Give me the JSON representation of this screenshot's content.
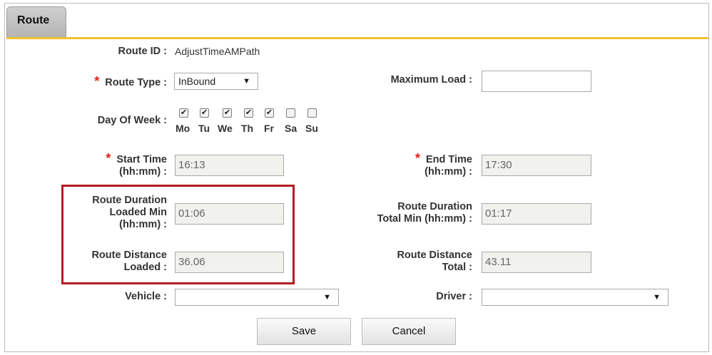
{
  "tab": {
    "label": "Route"
  },
  "form": {
    "route_id": {
      "label": "Route ID :",
      "value": "AdjustTimeAMPath"
    },
    "route_type": {
      "label": "Route Type :",
      "value": "InBound",
      "required_mark": "*"
    },
    "maximum_load": {
      "label": "Maximum Load :",
      "value": ""
    },
    "day_of_week": {
      "label": "Day Of Week :",
      "days": [
        {
          "label": "Mo",
          "checked": true,
          "mark": "✔"
        },
        {
          "label": "Tu",
          "checked": true,
          "mark": "✔"
        },
        {
          "label": "We",
          "checked": true,
          "mark": "✔"
        },
        {
          "label": "Th",
          "checked": true,
          "mark": "✔"
        },
        {
          "label": "Fr",
          "checked": true,
          "mark": "✔"
        },
        {
          "label": "Sa",
          "checked": false,
          "mark": ""
        },
        {
          "label": "Su",
          "checked": false,
          "mark": ""
        }
      ]
    },
    "start_time": {
      "label_line1": "Start Time",
      "label_line2": "(hh:mm) :",
      "value": "16:13",
      "required_mark": "*"
    },
    "end_time": {
      "label_line1": "End Time",
      "label_line2": "(hh:mm) :",
      "value": "17:30",
      "required_mark": "*"
    },
    "route_duration_loaded": {
      "label_line1": "Route Duration",
      "label_line2": "Loaded Min",
      "label_line3": "(hh:mm) :",
      "value": "01:06"
    },
    "route_duration_total": {
      "label_line1": "Route Duration",
      "label_line2": "Total Min (hh:mm) :",
      "value": "01:17"
    },
    "route_distance_loaded": {
      "label_line1": "Route Distance",
      "label_line2": "Loaded :",
      "value": "36.06"
    },
    "route_distance_total": {
      "label_line1": "Route Distance",
      "label_line2": "Total :",
      "value": "43.11"
    },
    "vehicle": {
      "label": "Vehicle :",
      "value": ""
    },
    "driver": {
      "label": "Driver :",
      "value": ""
    }
  },
  "buttons": {
    "save": "Save",
    "cancel": "Cancel"
  },
  "icons": {
    "dropdown": "chevron-down-icon",
    "check": "checkmark-icon"
  },
  "colors": {
    "tab_underline": "#f2c12e",
    "highlight_border": "#b31e23",
    "required": "#e0201b"
  }
}
